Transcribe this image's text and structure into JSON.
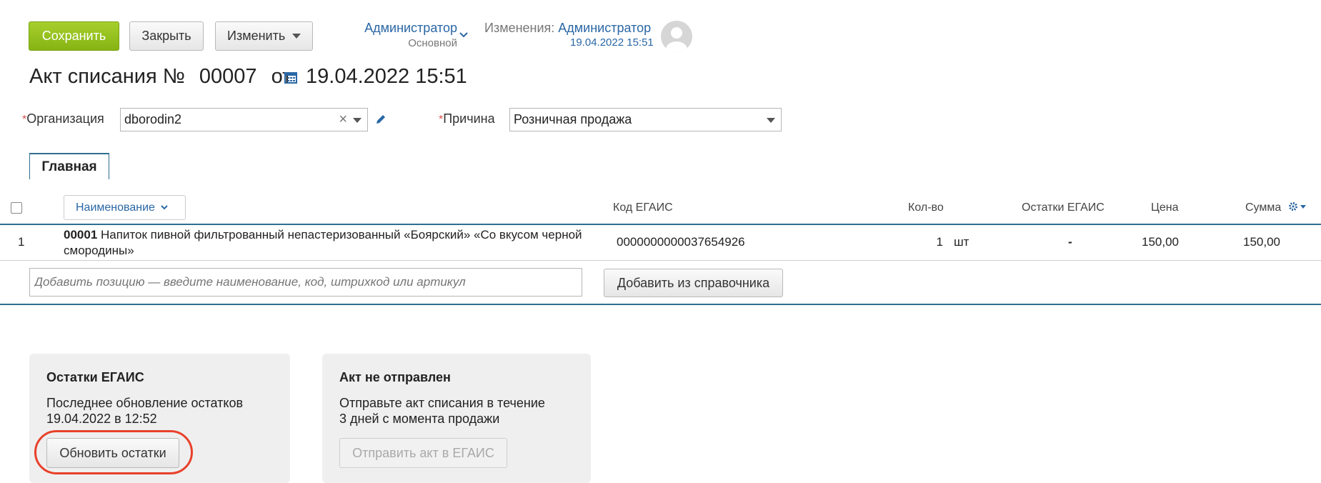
{
  "toolbar": {
    "save_label": "Сохранить",
    "close_label": "Закрыть",
    "edit_label": "Изменить"
  },
  "user": {
    "name": "Администратор",
    "role": "Основной",
    "changes_label": "Изменения:",
    "changes_user": "Администратор",
    "changes_time": "19.04.2022 15:51"
  },
  "doc": {
    "title_prefix": "Акт списания №",
    "number": "00007",
    "from": "от",
    "date": "19.04.2022 15:51"
  },
  "form": {
    "org_label": "Организация",
    "org_value": "dborodin2",
    "reason_label": "Причина",
    "reason_value": "Розничная продажа"
  },
  "tabs": [
    {
      "label": "Главная"
    }
  ],
  "table": {
    "headers": {
      "name": "Наименование",
      "code": "Код ЕГАИС",
      "qty": "Кол-во",
      "rest": "Остатки ЕГАИС",
      "price": "Цена",
      "sum": "Сумма"
    },
    "rows": [
      {
        "index": "1",
        "article": "00001",
        "name": "Напиток пивной фильтрованный непастеризованный «Боярский» «Со вкусом черной смородины»",
        "code": "0000000000037654926",
        "qty": "1",
        "unit": "шт",
        "rest": "-",
        "price": "150,00",
        "sum": "150,00"
      }
    ],
    "add_placeholder": "Добавить позицию — введите наименование, код, штрихкод или артикул",
    "add_from_catalog": "Добавить из справочника"
  },
  "cards": {
    "egais": {
      "title": "Остатки ЕГАИС",
      "line1": "Последнее обновление остатков",
      "line2": "19.04.2022 в 12:52",
      "button": "Обновить остатки"
    },
    "act": {
      "title": "Акт не отправлен",
      "line1": "Отправьте акт списания в течение",
      "line2": "3 дней с момента продажи",
      "button": "Отправить акт в ЕГАИС"
    }
  },
  "colors": {
    "primary": "#95c11f",
    "link": "#2a67a5",
    "highlight": "#e8412b",
    "divider": "#2f6f8f"
  }
}
